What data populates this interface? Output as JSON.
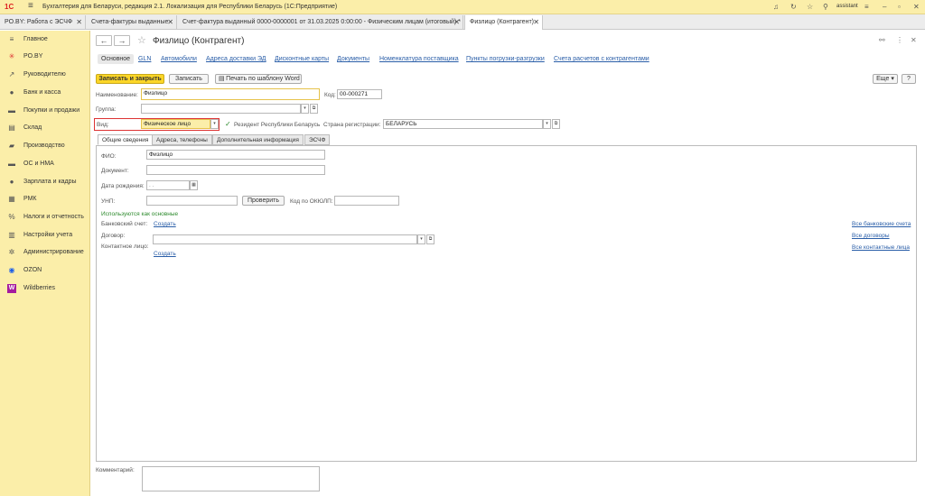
{
  "titlebar": {
    "logo": "1С",
    "title": "Бухгалтерия для Беларуси, редакция 2.1. Локализация для Республики Беларусь   (1С:Предприятие)",
    "user": "assistant"
  },
  "tabs": [
    {
      "label": "PO.BY: Работа с ЭСЧФ"
    },
    {
      "label": "Счета-фактуры выданные"
    },
    {
      "label": "Счет-фактура выданный 0000-0000001 от 31.03.2025 0:00:00 - Физическим лицам (итоговый) *"
    },
    {
      "label": "Физлицо (Контрагент)"
    }
  ],
  "sidebar": {
    "items": [
      {
        "label": "Главное",
        "icon": "≡"
      },
      {
        "label": "PO.BY",
        "icon": "✳"
      },
      {
        "label": "Руководителю",
        "icon": "↗"
      },
      {
        "label": "Банк и касса",
        "icon": "●"
      },
      {
        "label": "Покупки и продажи",
        "icon": "▬"
      },
      {
        "label": "Склад",
        "icon": "▤"
      },
      {
        "label": "Производство",
        "icon": "▰"
      },
      {
        "label": "ОС и НМА",
        "icon": "▬"
      },
      {
        "label": "Зарплата и кадры",
        "icon": "●"
      },
      {
        "label": "РМК",
        "icon": "▦"
      },
      {
        "label": "Налоги и отчетность",
        "icon": "%"
      },
      {
        "label": "Настройки учета",
        "icon": "▥"
      },
      {
        "label": "Администрирование",
        "icon": "✲"
      },
      {
        "label": "OZON",
        "icon": "◉"
      },
      {
        "label": "Wildberries",
        "icon": "W"
      }
    ]
  },
  "form": {
    "title": "Физлицо (Контрагент)",
    "subnav": [
      "Основное",
      "GLN",
      "Автомобили",
      "Адреса доставки ЭД",
      "Дисконтные карты",
      "Документы",
      "Номенклатура поставщика",
      "Пункты погрузки-разгрузки",
      "Счета расчетов с контрагентами"
    ],
    "buttons": {
      "save_close": "Записать и закрыть",
      "save": "Записать",
      "print": "Печать по шаблону Word",
      "more": "Еще",
      "help": "?"
    },
    "fields": {
      "name_label": "Наименование:",
      "name_value": "Физлицо",
      "code_label": "Код:",
      "code_value": "00-000271",
      "group_label": "Группа:",
      "group_value": "",
      "kind_label": "Вид:",
      "kind_value": "Физическое лицо",
      "resident_label": "Резидент Республики Беларусь",
      "country_label": "Страна регистрации:",
      "country_value": "БЕЛАРУСЬ"
    },
    "inner_tabs": [
      "Общие сведения",
      "Адреса, телефоны",
      "Дополнительная информация",
      "ЭСЧФ"
    ],
    "general": {
      "fio_label": "ФИО:",
      "fio_value": "Физлицо",
      "doc_label": "Документ:",
      "birth_label": "Дата рождения:",
      "birth_placeholder": " .  .",
      "unp_label": "УНП:",
      "check_button": "Проверить",
      "okpo_label": "Код по ОКЮЛП:",
      "main_note": "Используются как основные",
      "bank_label": "Банковский счет:",
      "bank_create": "Создать",
      "contract_label": "Договор:",
      "contact_label": "Контактное лицо:",
      "contact_create": "Создать",
      "all_bank": "Все банковские счета",
      "all_contracts": "Все договоры",
      "all_contacts": "Все контактные лица"
    },
    "comment_label": "Комментарий:"
  }
}
